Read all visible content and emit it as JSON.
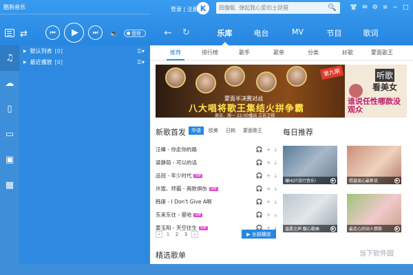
{
  "app": {
    "title": "酷狗音乐"
  },
  "player": {
    "prev_icon": "prev-icon",
    "play_icon": "play-icon",
    "next_icon": "next-icon",
    "sound_label": "音效"
  },
  "header": {
    "login": "登录 | 注册",
    "logo_letter": "K",
    "search_placeholder": "田馥甄  弹起我心爱的土琵琶",
    "tabs": [
      {
        "label": "乐库"
      },
      {
        "label": "电台"
      },
      {
        "label": "MV"
      },
      {
        "label": "节目"
      },
      {
        "label": "歌词"
      }
    ]
  },
  "playlist": {
    "items": [
      {
        "label": "默认列表",
        "count": "[0]"
      },
      {
        "label": "最近播放",
        "count": "[0]"
      }
    ]
  },
  "main": {
    "subtabs": [
      {
        "label": "推荐"
      },
      {
        "label": "排行榜"
      },
      {
        "label": "歌手"
      },
      {
        "label": "歌单"
      },
      {
        "label": "分类"
      },
      {
        "label": "好歌"
      },
      {
        "label": "蒙面歌王"
      }
    ],
    "banner": {
      "sub": "蒙面半决赛对战",
      "title": "八大唱将歌王集结火拼争霸",
      "time": "周日、周一 22:00播出  江苏卫视",
      "badge": "第九期"
    },
    "promo": {
      "t1": "听歌",
      "t2": "看美女",
      "t3": "谁说任性哪款没观众"
    },
    "new_songs": {
      "title": "新歌首发",
      "regions": [
        {
          "label": "华语"
        },
        {
          "label": "欧美"
        },
        {
          "label": "日韩"
        },
        {
          "label": "蒙面歌王"
        }
      ],
      "songs": [
        {
          "name": "汪峰 - 你走你的路",
          "vip": ""
        },
        {
          "name": "梁静茹 - 可以的话",
          "vip": ""
        },
        {
          "name": "品冠 - 年少时代",
          "vip": "VIP"
        },
        {
          "name": "许嵩、师霸 - 两败俱伤",
          "vip": "VIP"
        },
        {
          "name": "韩庚 - I Don't Give A啊",
          "vip": ""
        },
        {
          "name": "东来东往 - 曼哈",
          "vip": "VIP"
        },
        {
          "name": "姜玉阳 - 天空往生",
          "vip": "VIP"
        }
      ],
      "pages": [
        "1",
        "2",
        "3"
      ],
      "play_all": "全部播放"
    },
    "daily": {
      "title": "每日推荐",
      "cards": [
        {
          "caption": "爆HOT流行音乐!"
        },
        {
          "caption": "唱谐谈心最新说"
        },
        {
          "caption": "温柔之声 暖心歌曲"
        },
        {
          "caption": "最走心的动人情歌"
        }
      ]
    },
    "featured_title": "精选歌单"
  },
  "watermark": "当下软件园"
}
